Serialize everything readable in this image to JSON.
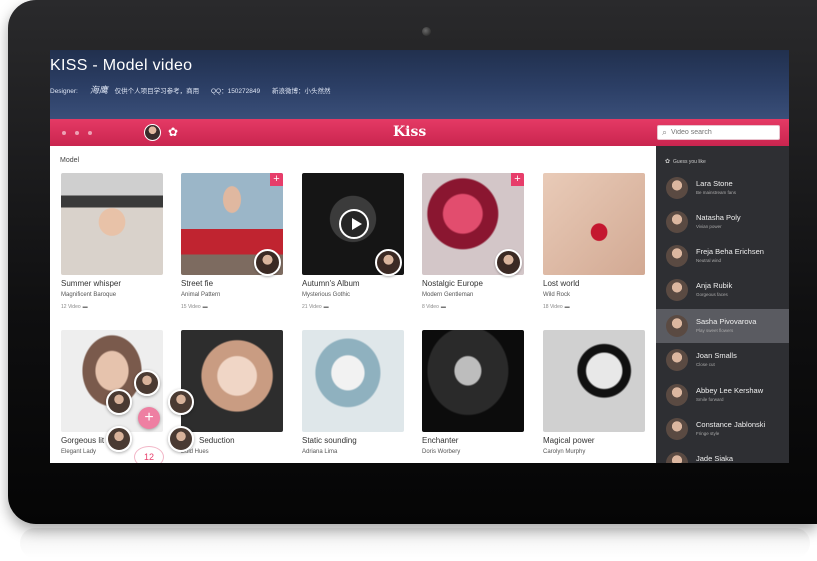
{
  "header": {
    "title": "KISS - Model video",
    "designer_label": "Designer:",
    "designer_signature": "海鹰",
    "designer_note": "仅供个人项目学习参考，商用",
    "qq_text": "QQ：150272849",
    "weibo_text": "新浪微博：小头然然"
  },
  "app_bar": {
    "brand": "Kiss",
    "search_placeholder": "Video search",
    "accent_color": "#d92b58"
  },
  "main": {
    "section_label": "Model",
    "fab_count": "12",
    "cards": [
      {
        "title": "Summer whisper",
        "subtitle": "Magnificent Baroque",
        "count": "12 Video"
      },
      {
        "title": "Street fie",
        "subtitle": "Animal Pattern",
        "count": "15 Video"
      },
      {
        "title": "Autumn's Album",
        "subtitle": "Mysterious Gothic",
        "count": "21 Video"
      },
      {
        "title": "Nostalgic Europe",
        "subtitle": "Modern Gentleman",
        "count": "8 Video"
      },
      {
        "title": "Lost world",
        "subtitle": "Wild Rock",
        "count": "18 Video"
      },
      {
        "title": "Gorgeous lit",
        "subtitle": "Elegant Lady",
        "count": ""
      },
      {
        "title": "Seduction",
        "subtitle": "Bold Hues",
        "count": ""
      },
      {
        "title": "Static sounding",
        "subtitle": "Adriana Lima",
        "count": ""
      },
      {
        "title": "Enchanter",
        "subtitle": "Doris Worbery",
        "count": ""
      },
      {
        "title": "Magical power",
        "subtitle": "Carolyn Murphy",
        "count": ""
      }
    ]
  },
  "sidebar": {
    "header": "Guess you like",
    "people": [
      {
        "name": "Lara Stone",
        "sub": "Be mainstream fans"
      },
      {
        "name": "Natasha Poly",
        "sub": "Vivian power"
      },
      {
        "name": "Freja Beha Erichsen",
        "sub": "Neutral wind"
      },
      {
        "name": "Anja Rubik",
        "sub": "Gorgeous faces"
      },
      {
        "name": "Sasha Pivovarova",
        "sub": "Play sweet flowers"
      },
      {
        "name": "Joan Smalls",
        "sub": "Close cut"
      },
      {
        "name": "Abbey Lee Kershaw",
        "sub": "Smile forward"
      },
      {
        "name": "Constance Jablonski",
        "sub": "Fringe style"
      },
      {
        "name": "Jade Siaka",
        "sub": ""
      }
    ]
  }
}
